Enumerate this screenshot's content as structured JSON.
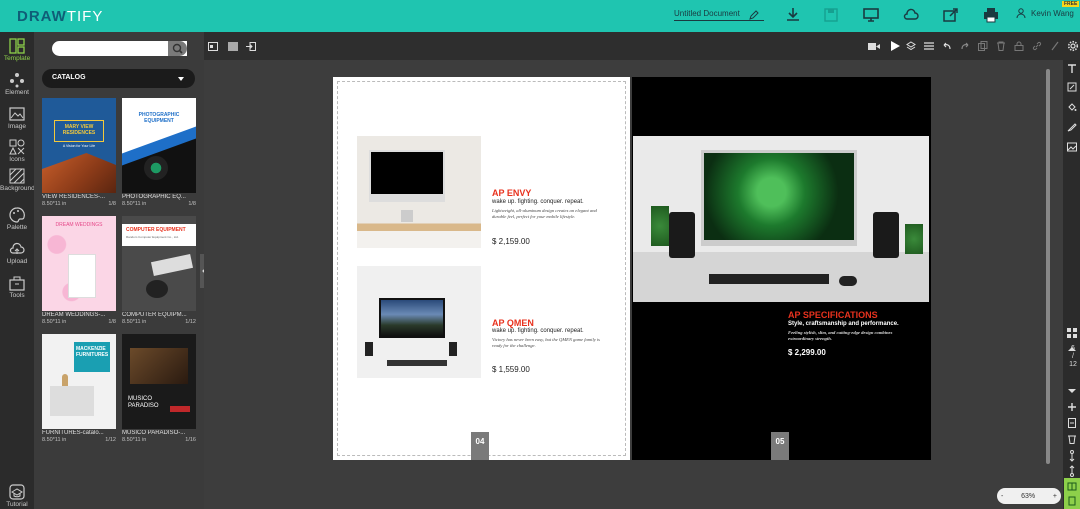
{
  "app": {
    "logo_a": "DRAW",
    "logo_b": "TIFY",
    "doc_title": "Untitled Document",
    "user": "Kevin Wang",
    "free_badge": "FREE"
  },
  "leftnav": [
    {
      "label": "Template",
      "icon": "template-icon",
      "active": true
    },
    {
      "label": "Element",
      "icon": "element-icon"
    },
    {
      "label": "Image",
      "icon": "image-icon"
    },
    {
      "label": "Icons",
      "icon": "icons-icon"
    },
    {
      "label": "Background",
      "icon": "background-icon"
    },
    {
      "label": "Palette",
      "icon": "palette-icon"
    },
    {
      "label": "Upload",
      "icon": "upload-icon"
    },
    {
      "label": "Tools",
      "icon": "tools-icon"
    },
    {
      "label": "Tutorial",
      "icon": "tutorial-icon"
    }
  ],
  "panel": {
    "search_placeholder": "",
    "catalog_label": "CATALOG",
    "templates": [
      {
        "name": "VIEW RESIDENCES-...",
        "size": "8.50*11 in",
        "pages": "1/8",
        "cover": "MARY VIEW RESIDENCES",
        "cover_sub": "A Vision for Your Life"
      },
      {
        "name": "PHOTOGRAPHIC EQ...",
        "size": "8.50*11 in",
        "pages": "1/8",
        "cover": "PHOTOGRAPHIC EQUIPMENT"
      },
      {
        "name": "DREAM WEDDINGS-...",
        "size": "8.50*11 in",
        "pages": "1/8",
        "cover": "DREAM WEDDINGS"
      },
      {
        "name": "COMPUTER EQUIPM...",
        "size": "8.50*11 in",
        "pages": "1/12",
        "cover": "COMPUTER EQUIPMENT",
        "cover_sub": "Random Computer Equipment Co., Ltd."
      },
      {
        "name": "FURNITURES-catalo...",
        "size": "8.50*11 in",
        "pages": "1/12",
        "cover": "MACKENZIE FURNITURES"
      },
      {
        "name": "MUSICO PARADISO-...",
        "size": "8.50*11 in",
        "pages": "1/16",
        "cover": "MUSICO PARADISO"
      }
    ]
  },
  "left_page": {
    "page_no": "04",
    "products": [
      {
        "title": "AP ENVY",
        "sub": "wake up. fighting. conquer. repeat.",
        "desc": "Lightweight, all-aluminum design creates an elegant and durable feel, perfect for your mobile lifestyle.",
        "price": "$ 2,159.00"
      },
      {
        "title": "AP QMEN",
        "sub": "wake up. fighting. conquer. repeat.",
        "desc": "Victory has never been easy, but the QMEN game family is ready for the challenge.",
        "price": "$ 1,559.00"
      }
    ]
  },
  "right_page": {
    "page_no": "05",
    "title": "AP SPECIFICATIONS",
    "sub": "Style, craftsmanship and performance.",
    "desc": "Feeling stylish, slim, and cutting-edge design combines extraordinary strength.",
    "price": "$ 2,299.00"
  },
  "pager": {
    "current": "6",
    "sep": "/",
    "total": "12"
  },
  "zoom": {
    "minus": "-",
    "value": "63%",
    "plus": "+"
  },
  "colors": {
    "brand": "#1fc5b0",
    "accent_red": "#e8321e",
    "active_green": "#8dd04a"
  }
}
